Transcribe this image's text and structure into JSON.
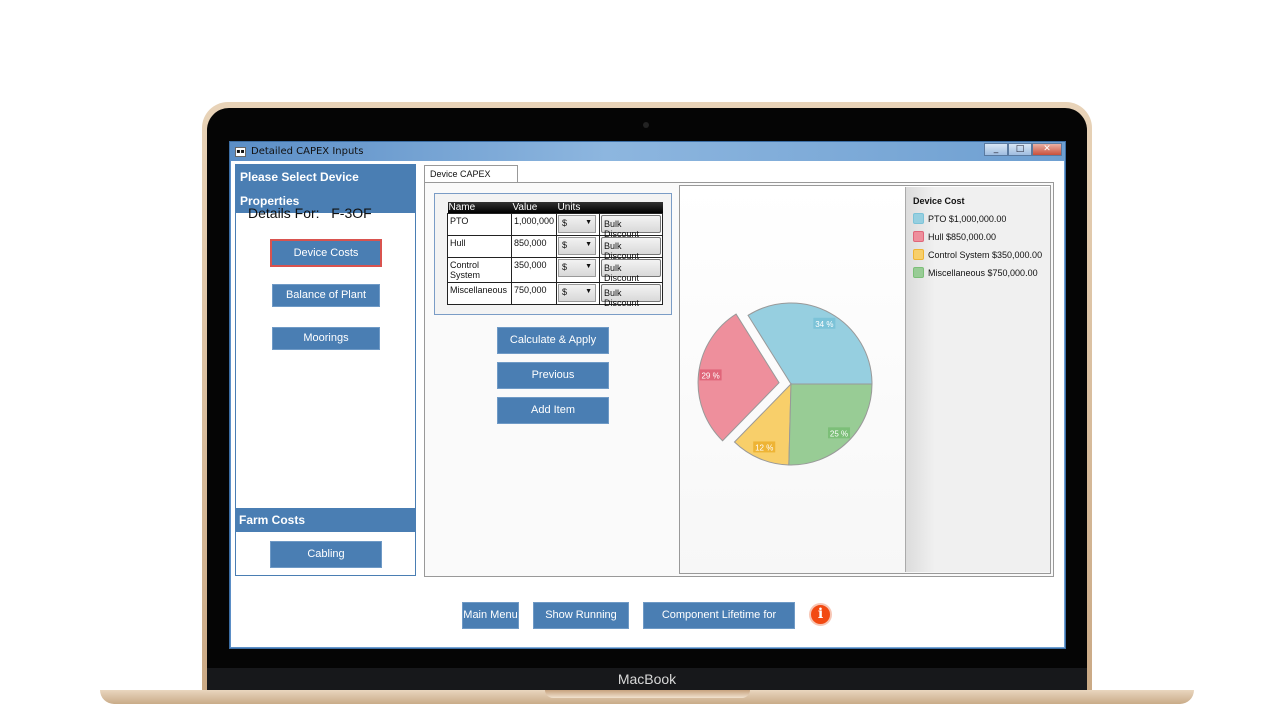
{
  "device": {
    "label": "MacBook"
  },
  "window": {
    "title": "Detailed CAPEX Inputs",
    "controls": [
      "_",
      "□",
      "✕"
    ]
  },
  "left": {
    "header": "Please Select Device Properties",
    "details_label": "Details For:",
    "details_value": "F-3OF",
    "buttons": [
      "Device Costs",
      "Balance of Plant",
      "Moorings"
    ],
    "farm_header": "Farm Costs",
    "farm_buttons": [
      "Cabling"
    ]
  },
  "tab": {
    "label": "Device CAPEX Inputs"
  },
  "grid": {
    "columns": [
      "Name",
      "Value",
      "Units",
      ""
    ],
    "rows": [
      {
        "name": "PTO",
        "value": "1,000,000",
        "unit": "$",
        "action": "Bulk Discount"
      },
      {
        "name": "Hull",
        "value": "850,000",
        "unit": "$",
        "action": "Bulk Discount"
      },
      {
        "name": "Control System",
        "value": "350,000",
        "unit": "$",
        "action": "Bulk Discount"
      },
      {
        "name": "Miscellaneous",
        "value": "750,000",
        "unit": "$",
        "action": "Bulk Discount"
      }
    ]
  },
  "actions": [
    "Calculate & Apply",
    "Previous",
    "Add Item"
  ],
  "footer": [
    "Main Menu",
    "Show Running Total",
    "Component Lifetime for Salvage"
  ],
  "info_icon": "info-icon",
  "chart_data": {
    "type": "pie",
    "legend_title": "Device Cost",
    "legend_position": "right",
    "categories": [
      "PTO",
      "Hull",
      "Control System",
      "Miscellaneous"
    ],
    "values": [
      1000000,
      850000,
      350000,
      750000
    ],
    "legend_labels": [
      "PTO $1,000,000.00",
      "Hull $850,000.00",
      "Control System $350,000.00",
      "Miscellaneous $750,000.00"
    ],
    "data_labels": [
      "34 %",
      "29 %",
      "12 %",
      "25 %"
    ],
    "colors": [
      "#96cfe0",
      "#ee8f9c",
      "#f8cf6a",
      "#98cc95"
    ],
    "label_colors": [
      "#7cc3d8",
      "#e0667a",
      "#eeb435",
      "#7cbf78"
    ],
    "exploded": "Hull"
  }
}
